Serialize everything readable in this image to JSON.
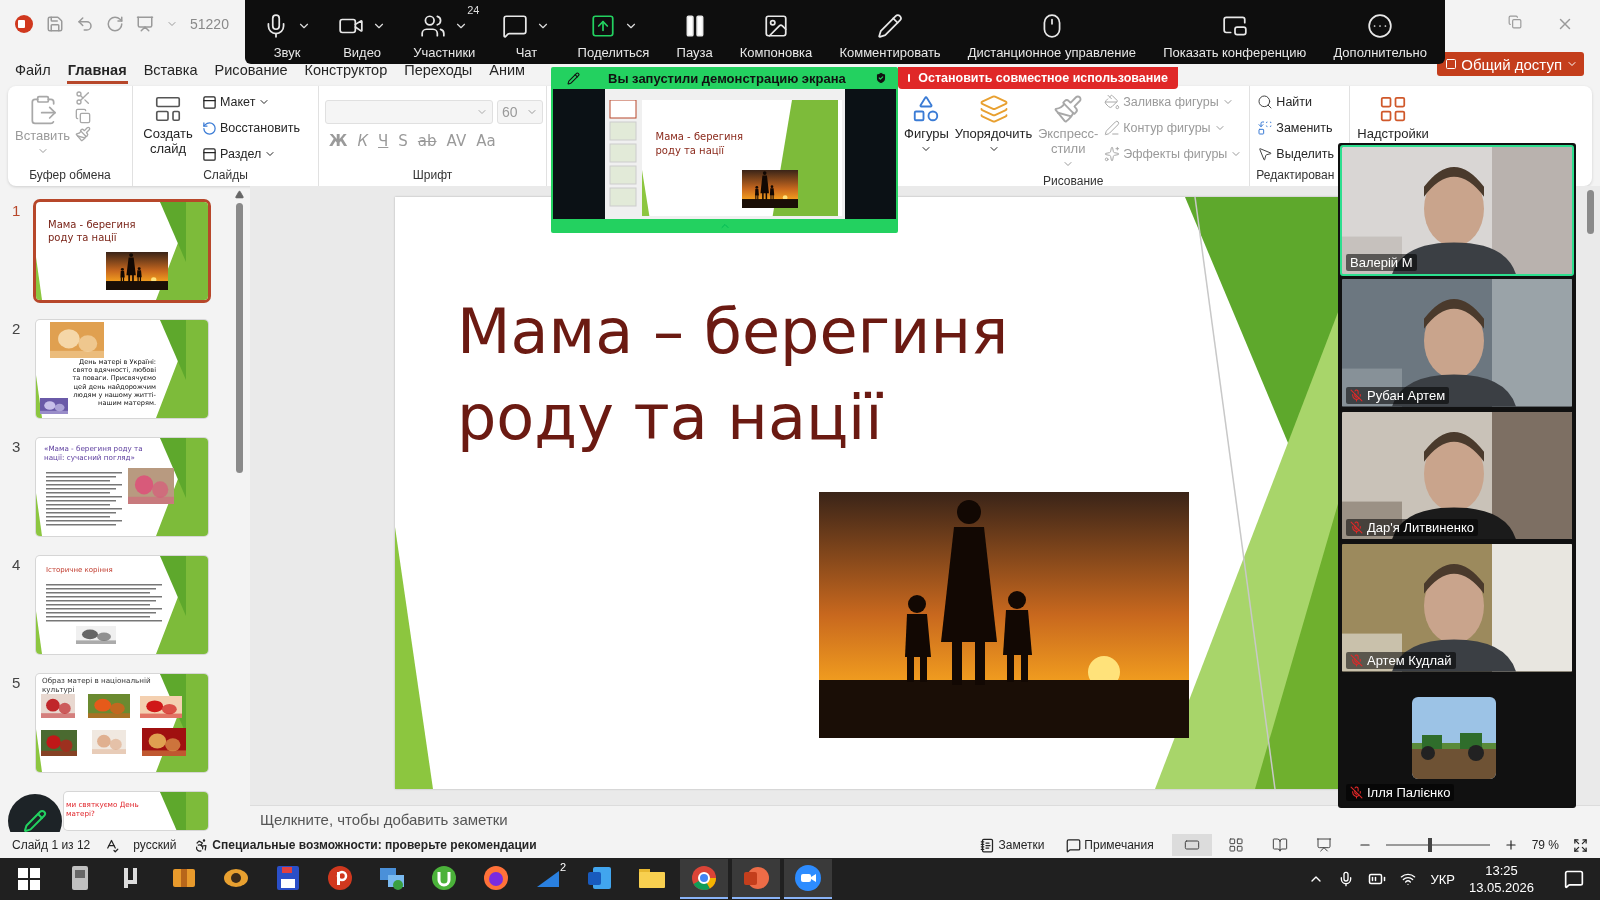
{
  "title_bar": {
    "file_name": "51220"
  },
  "zoom_toolbar": [
    {
      "kind": "audio",
      "label": "Звук",
      "menu": true
    },
    {
      "kind": "video",
      "label": "Видео",
      "menu": true
    },
    {
      "kind": "participants",
      "label": "Участники",
      "count": "24",
      "menu": true
    },
    {
      "kind": "chat",
      "label": "Чат",
      "menu": true
    },
    {
      "kind": "share",
      "label": "Поделиться",
      "menu": true
    },
    {
      "kind": "pause",
      "label": "Пауза",
      "menu": false
    },
    {
      "kind": "layout",
      "label": "Компоновка",
      "menu": false
    },
    {
      "kind": "annotate",
      "label": "Комментировать",
      "menu": false
    },
    {
      "kind": "remote",
      "label": "Дистанционное управление",
      "menu": false
    },
    {
      "kind": "show_meeting",
      "label": "Показать конференцию",
      "menu": false
    },
    {
      "kind": "more",
      "label": "Дополнительно",
      "menu": false
    }
  ],
  "ribbon_tabs": [
    {
      "label": "Файл",
      "selected": false
    },
    {
      "label": "Главная",
      "selected": true
    },
    {
      "label": "Вставка",
      "selected": false
    },
    {
      "label": "Рисование",
      "selected": false
    },
    {
      "label": "Конструктор",
      "selected": false
    },
    {
      "label": "Переходы",
      "selected": false
    },
    {
      "label": "Аним",
      "selected": false
    }
  ],
  "share_button": "Общий доступ",
  "ribbon": {
    "clipboard": {
      "title": "Буфер обмена",
      "paste": "Вставить"
    },
    "slides": {
      "title": "Слайды",
      "new_slide": "Создать слайд",
      "items": [
        "Макет",
        "Восстановить",
        "Раздел"
      ]
    },
    "font": {
      "title": "Шрифт",
      "size": "60",
      "styles": [
        "Ж",
        "К",
        "Ч",
        "S",
        "ab",
        "AV",
        "Aa"
      ]
    },
    "drawing": {
      "title": "Рисование",
      "tools": [
        {
          "kind": "shapes",
          "label": "Фигуры",
          "disabled": false
        },
        {
          "kind": "arrange",
          "label": "Упорядочить",
          "disabled": false
        },
        {
          "kind": "styles",
          "label": "Экспресс-стили",
          "disabled": true
        }
      ],
      "format": [
        {
          "kind": "fill",
          "label": "Заливка фигуры",
          "disabled": true
        },
        {
          "kind": "outline",
          "label": "Контур фигуры",
          "disabled": true
        },
        {
          "kind": "effects",
          "label": "Эффекты фигуры",
          "disabled": true
        }
      ]
    },
    "editing": {
      "title": "Редактирован",
      "items": [
        {
          "kind": "find",
          "label": "Найти"
        },
        {
          "kind": "replace",
          "label": "Заменить"
        },
        {
          "kind": "select",
          "label": "Выделить"
        }
      ]
    },
    "addins": {
      "label": "Надстройки"
    }
  },
  "share_notice": {
    "banner": "Вы запустили демонстрацию экрана",
    "stop": "Остановить совместное использование",
    "preview_title": "Мама - берегиня роду та нації"
  },
  "thumbnails": [
    {
      "number": "1",
      "selected": true,
      "kind": "title",
      "title": "Мама - берегиня роду та нації"
    },
    {
      "number": "2",
      "selected": false,
      "kind": "text",
      "title": "День матері в Україні: свято вдячності, любові та поваги. Присвячуємо цей день найдорожчим людям у нашому житті- нашим матерям."
    },
    {
      "number": "3",
      "selected": false,
      "kind": "article",
      "title": "«Мама - берегиня роду та нації: сучасний погляд»"
    },
    {
      "number": "4",
      "selected": false,
      "kind": "history",
      "title": "Історичне коріння"
    },
    {
      "number": "5",
      "selected": false,
      "kind": "gallery",
      "title": "Образ матері в національній культурі"
    },
    {
      "selected": false,
      "kind": "question",
      "title": "ми святкуємо День матері?"
    }
  ],
  "slide": {
    "title": "Мама – берегиня роду та нації"
  },
  "notes": {
    "placeholder": "Щелкните, чтобы добавить заметки"
  },
  "participants": [
    {
      "name": "Валерій М",
      "selected": true,
      "muted": false,
      "kind": "video"
    },
    {
      "name": "Рубан Артем",
      "selected": false,
      "muted": true,
      "kind": "video"
    },
    {
      "name": "Дар'я Литвиненко",
      "selected": false,
      "muted": true,
      "kind": "video"
    },
    {
      "name": "Артем Кудлай",
      "selected": false,
      "muted": true,
      "kind": "video"
    },
    {
      "name": "Ілля Палієнко",
      "selected": false,
      "muted": true,
      "kind": "avatar"
    }
  ],
  "status_bar": {
    "slide": "Слайд 1 из 12",
    "language": "русский",
    "accessibility": "Специальные возможности: проверьте рекомендации",
    "notes": "Заметки",
    "comments": "Примечания",
    "views": [
      {
        "kind": "normal",
        "selected": true
      },
      {
        "kind": "sorter",
        "selected": false
      },
      {
        "kind": "reading",
        "selected": false
      },
      {
        "kind": "slideshow",
        "selected": false
      }
    ],
    "zoom": {
      "level": 0.43,
      "reading": "79 %"
    }
  },
  "taskbar": {
    "apps": [
      {
        "kind": "disk",
        "active": false
      },
      {
        "kind": "mu",
        "active": false
      },
      {
        "kind": "archive",
        "active": false
      },
      {
        "kind": "eye",
        "active": false
      },
      {
        "kind": "floppy",
        "active": false
      },
      {
        "kind": "red_p",
        "active": false
      },
      {
        "kind": "network",
        "active": false
      },
      {
        "kind": "torrent",
        "active": false
      },
      {
        "kind": "firefox",
        "active": false
      },
      {
        "kind": "signal",
        "active": false,
        "badge": "2"
      },
      {
        "kind": "word",
        "active": false
      },
      {
        "kind": "folder",
        "active": false
      },
      {
        "kind": "chrome",
        "active": true
      },
      {
        "kind": "powerpoint",
        "active": true
      },
      {
        "kind": "zoom",
        "active": true
      }
    ],
    "language": "УКР",
    "time": "13:25",
    "date": "13.05.2026"
  }
}
